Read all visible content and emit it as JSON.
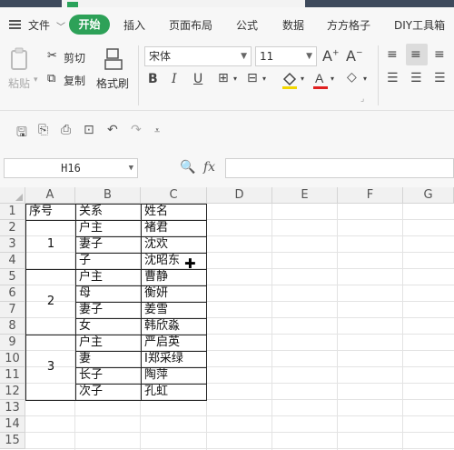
{
  "menu": {
    "file": "文件",
    "tabs": [
      "开始",
      "插入",
      "页面布局",
      "公式",
      "数据",
      "方方格子",
      "DIY工具箱"
    ]
  },
  "ribbon": {
    "paste": "粘贴",
    "cut": "剪切",
    "copy": "复制",
    "format_painter": "格式刷",
    "font_name": "宋体",
    "font_size": "11"
  },
  "formula_bar": {
    "cell_ref": "H16",
    "fx": "fx",
    "value": ""
  },
  "sheet": {
    "columns": [
      "A",
      "B",
      "C",
      "D",
      "E",
      "F",
      "G"
    ],
    "rows": [
      "1",
      "2",
      "3",
      "4",
      "5",
      "6",
      "7",
      "8",
      "9",
      "10",
      "11",
      "12",
      "13",
      "14",
      "15"
    ],
    "header": {
      "A": "序号",
      "B": "关系",
      "C": "姓名"
    },
    "groups": [
      "1",
      "2",
      "3"
    ],
    "records": [
      {
        "rel": "户主",
        "name": "褚君"
      },
      {
        "rel": "妻子",
        "name": "沈欢"
      },
      {
        "rel": "子",
        "name": "沈昭东"
      },
      {
        "rel": "户主",
        "name": "曹静"
      },
      {
        "rel": "母",
        "name": "衡妍"
      },
      {
        "rel": "妻子",
        "name": "姜雪"
      },
      {
        "rel": "女",
        "name": "韩欣淼"
      },
      {
        "rel": "户主",
        "name": "严启英"
      },
      {
        "rel": "妻",
        "name": "I郑采绿"
      },
      {
        "rel": "长子",
        "name": "陶萍"
      },
      {
        "rel": "次子",
        "name": "孔虹"
      }
    ]
  }
}
